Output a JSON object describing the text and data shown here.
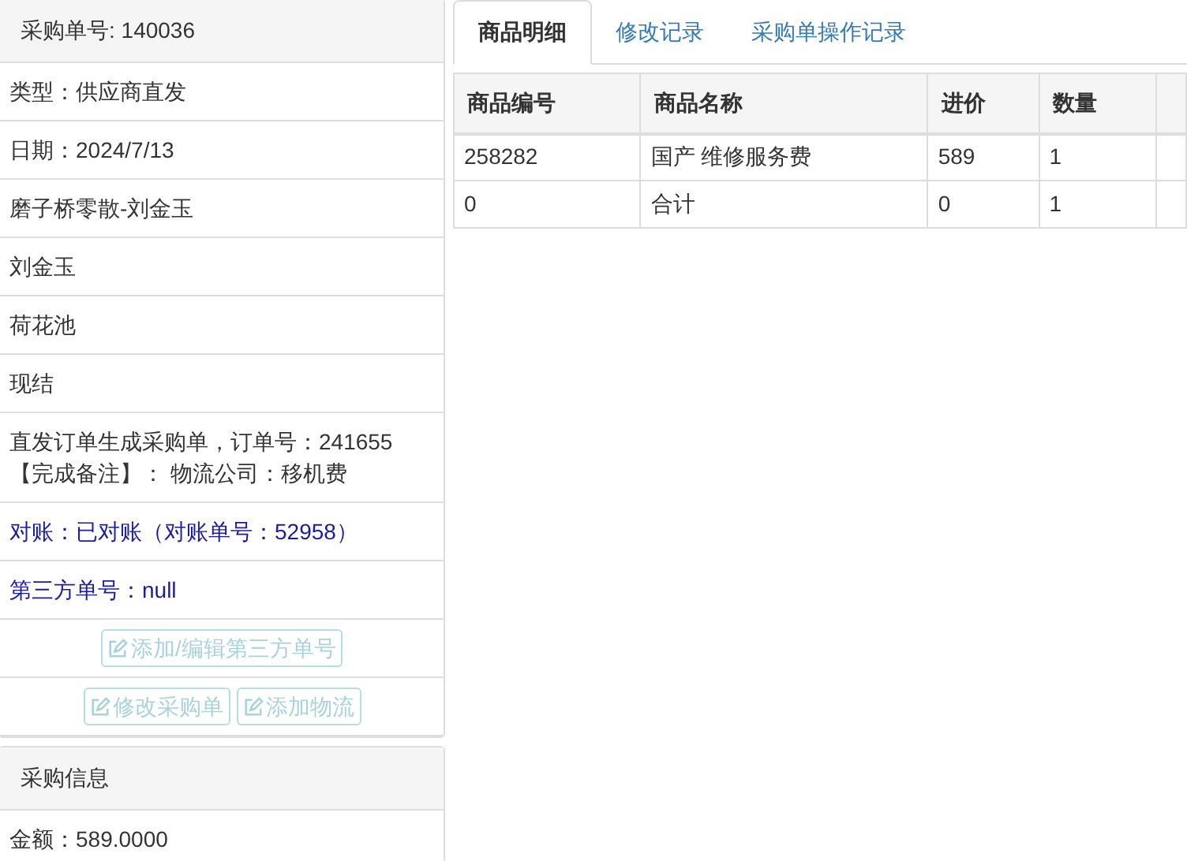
{
  "order_panel": {
    "title": "采购单号: 140036",
    "rows": [
      {
        "kind": "text",
        "lines": [
          "类型：供应商直发"
        ]
      },
      {
        "kind": "text",
        "lines": [
          "日期：2024/7/13"
        ]
      },
      {
        "kind": "text",
        "lines": [
          "磨子桥零散-刘金玉"
        ]
      },
      {
        "kind": "text",
        "lines": [
          "刘金玉"
        ]
      },
      {
        "kind": "text",
        "lines": [
          "荷花池"
        ]
      },
      {
        "kind": "text",
        "lines": [
          "现结"
        ]
      },
      {
        "kind": "text",
        "lines": [
          "直发订单生成采购单，订单号：241655",
          "【完成备注】： 物流公司：移机费"
        ]
      },
      {
        "kind": "status",
        "lines": [
          "对账：已对账（对账单号：52958）"
        ]
      },
      {
        "kind": "status",
        "lines": [
          "第三方单号：null"
        ]
      },
      {
        "kind": "actions",
        "buttons": [
          {
            "label": "添加/编辑第三方单号",
            "disabled": true
          }
        ]
      },
      {
        "kind": "actions",
        "buttons": [
          {
            "label": "修改采购单",
            "disabled": true
          },
          {
            "label": "添加物流",
            "disabled": true
          }
        ]
      }
    ]
  },
  "purchase_panel": {
    "title": "采购信息",
    "rows": [
      {
        "kind": "text",
        "lines": [
          "金额：589.0000"
        ]
      }
    ]
  },
  "tabs": [
    {
      "label": "商品明细",
      "selected": true
    },
    {
      "label": "修改记录",
      "selected": false
    },
    {
      "label": "采购单操作记录",
      "selected": false
    }
  ],
  "table": {
    "columns": [
      "商品编号",
      "商品名称",
      "进价",
      "数量"
    ],
    "rows": [
      [
        "258282",
        "国产 维修服务费",
        "589",
        "1"
      ],
      [
        "0",
        "合计",
        "0",
        "1"
      ]
    ]
  }
}
